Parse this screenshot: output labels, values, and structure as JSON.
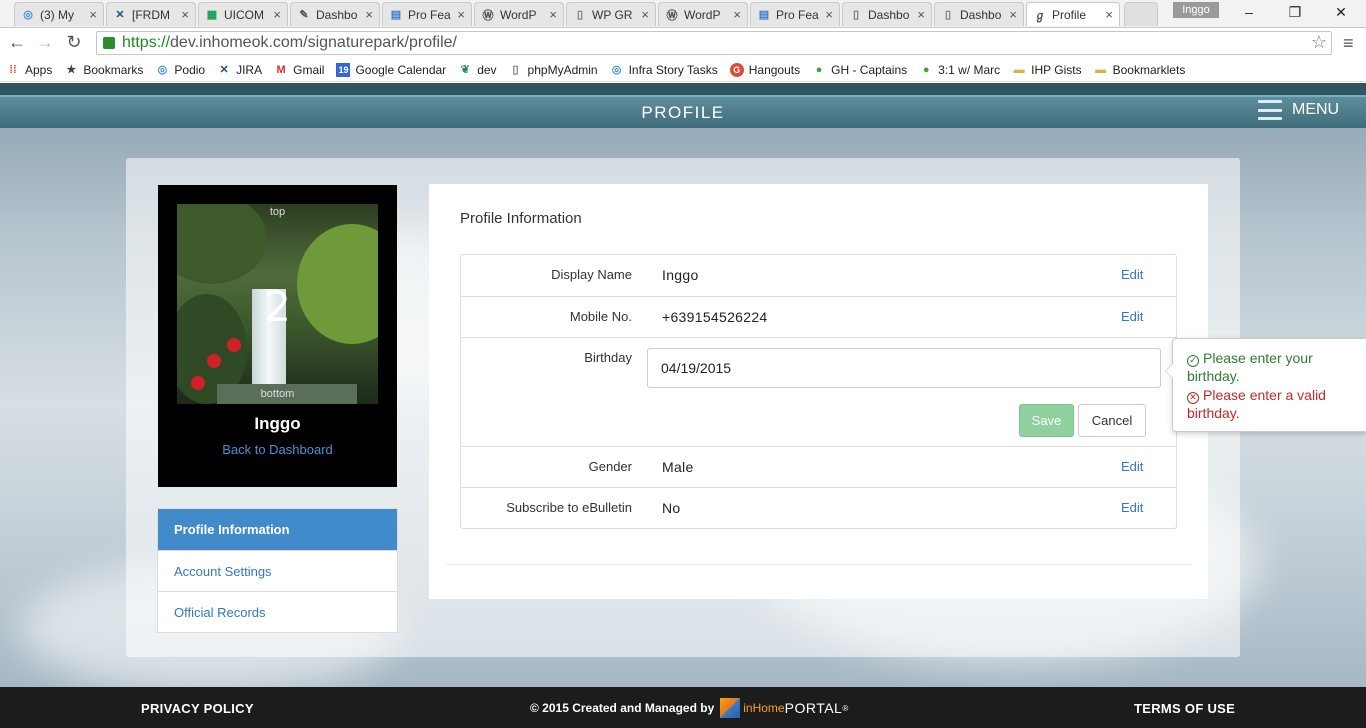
{
  "browser": {
    "tabs": [
      {
        "title": "(3) My",
        "icon": "podio-icon",
        "color": "#3d8fd6"
      },
      {
        "title": "[FRDM",
        "icon": "jira-icon",
        "color": "#205081"
      },
      {
        "title": "UICOM",
        "icon": "sheets-icon",
        "color": "#0f9d58"
      },
      {
        "title": "Dashbo",
        "icon": "dashboard-icon",
        "color": "#555555"
      },
      {
        "title": "Pro Fea",
        "icon": "doc-icon",
        "color": "#3a7cc7"
      },
      {
        "title": "WordP",
        "icon": "wordpress-icon",
        "color": "#464646"
      },
      {
        "title": "WP GR",
        "icon": "page-icon",
        "color": "#777777"
      },
      {
        "title": "WordP",
        "icon": "wordpress-icon",
        "color": "#464646"
      },
      {
        "title": "Pro Fea",
        "icon": "doc-icon",
        "color": "#3a7cc7"
      },
      {
        "title": "Dashbo",
        "icon": "page-icon",
        "color": "#777777"
      },
      {
        "title": "Dashbo",
        "icon": "page-icon",
        "color": "#777777"
      },
      {
        "title": "Profile",
        "icon": "signature-icon",
        "color": "#555555",
        "active": true
      }
    ],
    "user_name": "Inggo",
    "url_secure": "https://",
    "url_rest": "dev.inhomeok.com/signaturepark/profile/",
    "bookmarks": [
      {
        "label": "Apps",
        "icon": "apps-grid-icon"
      },
      {
        "label": "Bookmarks",
        "icon": "star-icon"
      },
      {
        "label": "Podio",
        "icon": "podio-icon"
      },
      {
        "label": "JIRA",
        "icon": "jira-icon"
      },
      {
        "label": "Gmail",
        "icon": "gmail-icon"
      },
      {
        "label": "Google Calendar",
        "icon": "calendar-icon"
      },
      {
        "label": "dev",
        "icon": "leaf-icon"
      },
      {
        "label": "phpMyAdmin",
        "icon": "page-icon"
      },
      {
        "label": "Infra Story Tasks",
        "icon": "podio-icon"
      },
      {
        "label": "Hangouts",
        "icon": "google-plus-icon"
      },
      {
        "label": "GH - Captains",
        "icon": "evernote-icon"
      },
      {
        "label": "3:1 w/ Marc",
        "icon": "evernote-icon"
      },
      {
        "label": "IHP Gists",
        "icon": "folder-icon"
      },
      {
        "label": "Bookmarklets",
        "icon": "folder-icon"
      }
    ]
  },
  "header": {
    "title": "PROFILE",
    "menu_label": "MENU"
  },
  "profile": {
    "photo_number": "2",
    "photo_top": "top",
    "photo_bottom": "bottom",
    "name": "Inggo",
    "back_link": "Back to Dashboard"
  },
  "sidenav": {
    "items": [
      {
        "label": "Profile Information",
        "active": true
      },
      {
        "label": "Account Settings"
      },
      {
        "label": "Official Records"
      }
    ]
  },
  "panel": {
    "title": "Profile Information",
    "rows": [
      {
        "label": "Display Name",
        "value": "Inggo",
        "edit": "Edit"
      },
      {
        "label": "Mobile No.",
        "value": "+639154526224",
        "edit": "Edit"
      },
      {
        "label": "Birthday",
        "input_value": "04/19/2015",
        "save": "Save",
        "cancel": "Cancel"
      },
      {
        "label": "Gender",
        "value": "Male",
        "edit": "Edit"
      },
      {
        "label": "Subscribe to eBulletin",
        "value": "No",
        "edit": "Edit"
      }
    ]
  },
  "validation": {
    "ok_message": "Please enter your birthday.",
    "error_message": "Please enter a valid birthday."
  },
  "footer": {
    "privacy": "PRIVACY POLICY",
    "credit": "© 2015 Created and Managed by",
    "logo_in": "inHome",
    "logo_portal": "PORTAL",
    "logo_mark": "®",
    "terms": "TERMS OF USE"
  },
  "colors": {
    "accent": "#428bca",
    "link": "#337ab7",
    "header": "#4f7d8b",
    "save_disabled": "#8fd19e",
    "valid": "#2e7d32",
    "invalid": "#c62828"
  }
}
